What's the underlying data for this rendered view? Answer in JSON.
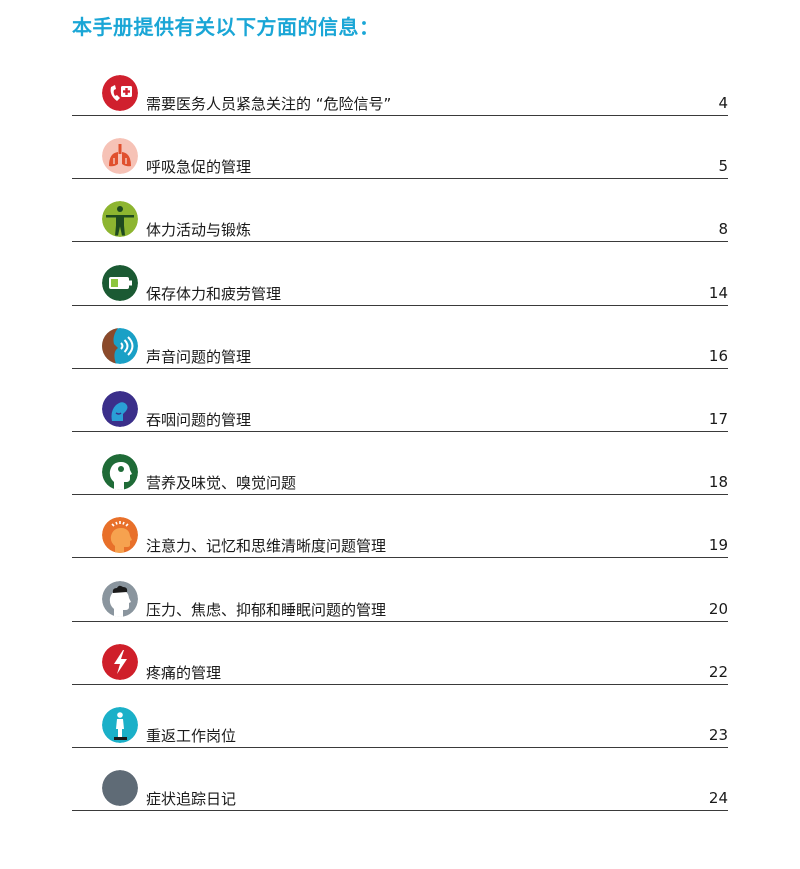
{
  "title": "本手册提供有关以下方面的信息：",
  "entries": [
    {
      "label": "需要医务人员紧急关注的 “危险信号”",
      "page": "4",
      "icon": "phone-cross-icon",
      "color": "#d0202e"
    },
    {
      "label": "呼吸急促的管理",
      "page": "5",
      "icon": "lungs-icon",
      "color": "#f1a394"
    },
    {
      "label": "体力活动与锻炼",
      "page": "8",
      "icon": "person-arms-out-icon",
      "color": "#8db530"
    },
    {
      "label": "保存体力和疲劳管理",
      "page": "14",
      "icon": "battery-icon",
      "color": "#1b5a33"
    },
    {
      "label": "声音问题的管理",
      "page": "16",
      "icon": "voice-waves-icon",
      "color": "#1aa0c6"
    },
    {
      "label": "吞咽问题的管理",
      "page": "17",
      "icon": "throat-icon",
      "color": "#3b2f8a"
    },
    {
      "label": "营养及味觉、嗅觉问题",
      "page": "18",
      "icon": "head-profile-nutrition-icon",
      "color": "#1f6b37"
    },
    {
      "label": "注意力、记忆和思维清晰度问题管理",
      "page": "19",
      "icon": "brain-head-icon",
      "color": "#e8702a"
    },
    {
      "label": "压力、焦虑、抑郁和睡眠问题的管理",
      "page": "20",
      "icon": "head-cloud-icon",
      "color": "#8a959e"
    },
    {
      "label": "疼痛的管理",
      "page": "22",
      "icon": "lightning-icon",
      "color": "#cf1f2a"
    },
    {
      "label": "重返工作岗位",
      "page": "23",
      "icon": "worker-icon",
      "color": "#1bb0c8"
    },
    {
      "label": "症状追踪日记",
      "page": "24",
      "icon": "diary-icon",
      "color": "#5f6b76"
    }
  ]
}
